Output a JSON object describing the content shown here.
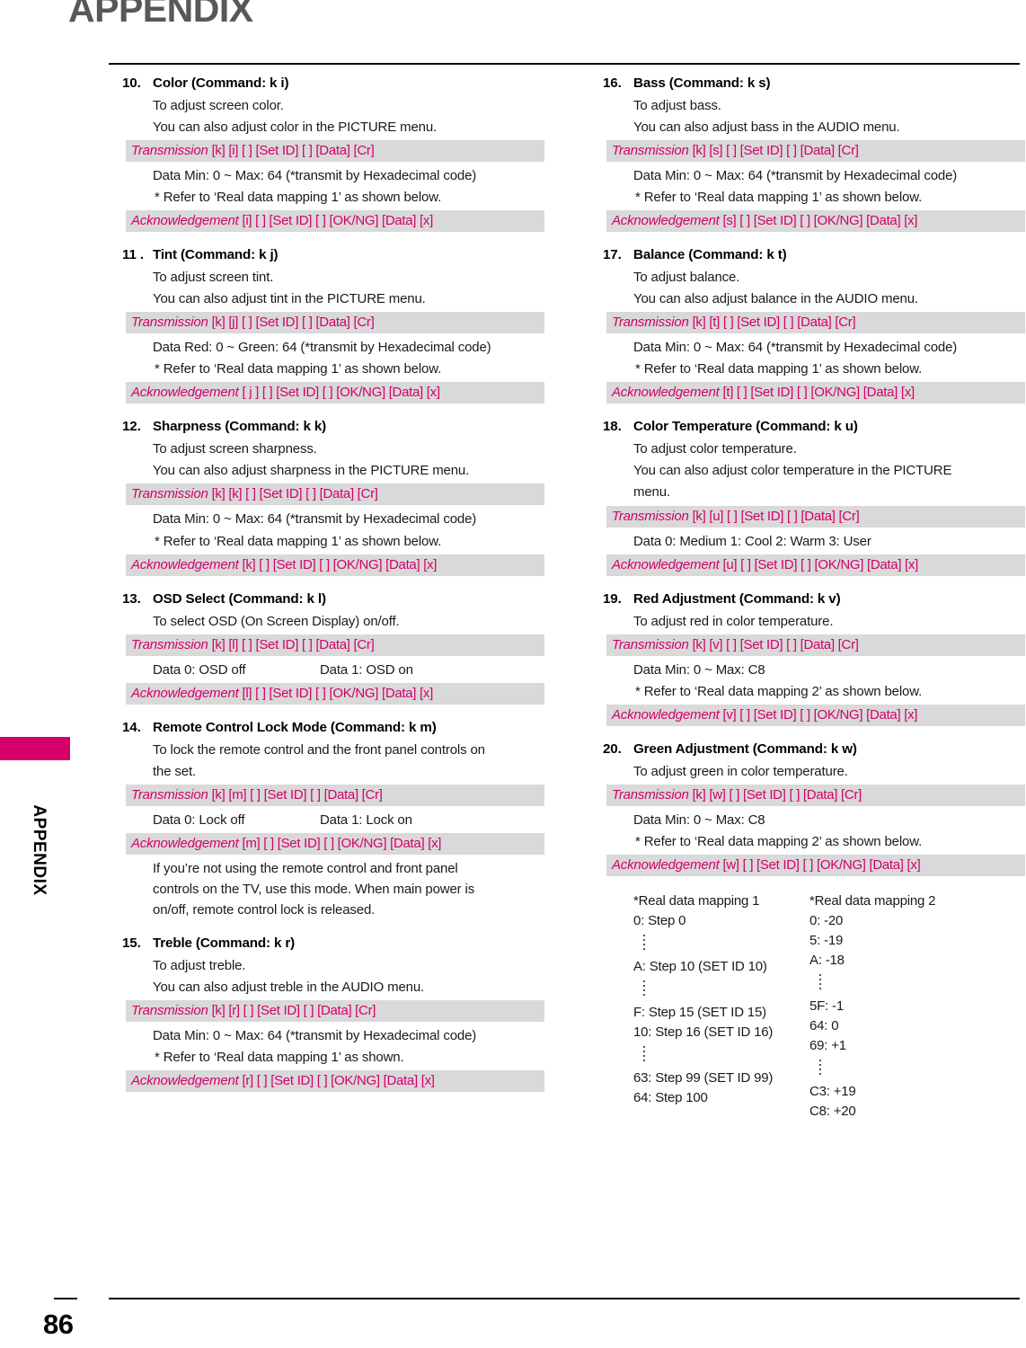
{
  "header": {
    "title": "APPENDIX"
  },
  "side": {
    "tab_label": "APPENDIX"
  },
  "footer": {
    "page_number": "86"
  },
  "items": [
    {
      "num": "10.",
      "title": "Color (Command: k i)",
      "lines": [
        "To adjust screen color.",
        "You can also adjust color in the PICTURE menu."
      ],
      "transmission": {
        "keyword": "Transmission",
        "tokens": "[k] [i] [    ] [Set ID] [    ] [Data] [Cr]"
      },
      "data_lines": [
        "Data Min: 0 ~ Max: 64 (*transmit by Hexadecimal code)"
      ],
      "note": "*  Refer to ‘Real data mapping 1’ as shown below.",
      "ack": {
        "keyword": "Acknowledgement",
        "tokens": "[i] [    ] [Set ID] [    ] [OK/NG] [Data] [x]"
      }
    },
    {
      "num": "11 .",
      "title": "Tint (Command: k j)",
      "lines": [
        "To adjust screen tint.",
        "You can also adjust tint in the PICTURE menu."
      ],
      "transmission": {
        "keyword": "Transmission",
        "tokens": "[k] [j] [    ] [Set ID] [    ] [Data] [Cr]"
      },
      "data_lines": [
        "Data Red: 0 ~ Green: 64 (*transmit by Hexadecimal code)"
      ],
      "note": "*  Refer to ‘Real data mapping 1’ as shown below.",
      "ack": {
        "keyword": "Acknowledgement",
        "tokens": "[ j ] [    ] [Set ID] [    ] [OK/NG] [Data] [x]"
      }
    },
    {
      "num": "12.",
      "title": "Sharpness (Command: k k)",
      "lines": [
        "To adjust screen sharpness.",
        "You can also adjust sharpness in the PICTURE menu."
      ],
      "transmission": {
        "keyword": "Transmission",
        "tokens": "[k] [k] [    ] [Set ID] [    ] [Data] [Cr]"
      },
      "data_lines": [
        "Data Min: 0 ~ Max: 64 (*transmit by Hexadecimal code)"
      ],
      "note": "*  Refer to ‘Real data mapping 1’ as shown below.",
      "ack": {
        "keyword": "Acknowledgement",
        "tokens": "[k] [    ] [Set ID] [    ] [OK/NG] [Data] [x]"
      }
    },
    {
      "num": "13.",
      "title": "OSD Select (Command: k l)",
      "lines": [
        "To select OSD (On Screen Display) on/off."
      ],
      "transmission": {
        "keyword": "Transmission",
        "tokens": "[k] [l] [    ] [Set ID] [    ] [Data] [Cr]"
      },
      "data_pair": {
        "left": "Data 0: OSD off",
        "right": "Data 1: OSD on"
      },
      "ack": {
        "keyword": "Acknowledgement",
        "tokens": "[l] [    ] [Set ID] [    ] [OK/NG] [Data] [x]"
      }
    },
    {
      "num": "14.",
      "title": "Remote Control Lock Mode (Command: k m)",
      "lines": [
        "To lock the remote control and the front panel controls on",
        "the set."
      ],
      "transmission": {
        "keyword": "Transmission",
        "tokens": "[k] [m] [    ] [Set ID] [    ] [Data] [Cr]"
      },
      "data_pair": {
        "left": "Data 0: Lock off",
        "right": "Data 1: Lock on"
      },
      "ack": {
        "keyword": "Acknowledgement",
        "tokens": "[m] [    ] [Set ID] [    ] [OK/NG] [Data] [x]"
      },
      "after_lines": [
        "If you’re not using the remote control and front panel",
        "controls on the TV, use this mode. When main power is",
        "on/off, remote control lock is released."
      ]
    },
    {
      "num": "15.",
      "title": "Treble (Command: k r)",
      "lines": [
        "To adjust treble.",
        "You can also adjust treble in the AUDIO menu."
      ],
      "transmission": {
        "keyword": "Transmission",
        "tokens": "[k] [r] [    ] [Set ID] [    ] [Data] [Cr]"
      },
      "data_lines": [
        "Data Min: 0 ~ Max: 64 (*transmit by Hexadecimal code)"
      ],
      "note": "*  Refer to ‘Real data mapping 1’ as shown.",
      "ack": {
        "keyword": "Acknowledgement",
        "tokens": "[r] [    ] [Set ID] [    ] [OK/NG] [Data] [x]"
      }
    },
    {
      "num": "16.",
      "title": "Bass (Command: k s)",
      "lines": [
        "To adjust bass.",
        "You can also adjust bass in the AUDIO menu."
      ],
      "transmission": {
        "keyword": "Transmission",
        "tokens": "[k] [s] [    ] [Set ID] [    ] [Data] [Cr]"
      },
      "data_lines": [
        "Data Min: 0 ~ Max: 64 (*transmit by Hexadecimal code)"
      ],
      "note": "*  Refer to ‘Real data mapping 1’ as shown below.",
      "ack": {
        "keyword": "Acknowledgement",
        "tokens": "[s] [    ] [Set ID] [    ] [OK/NG] [Data] [x]"
      }
    },
    {
      "num": "17.",
      "title": "Balance (Command: k t)",
      "lines": [
        "To adjust balance.",
        "You can also adjust balance in the AUDIO menu."
      ],
      "transmission": {
        "keyword": "Transmission",
        "tokens": "[k] [t] [    ] [Set ID] [    ] [Data] [Cr]"
      },
      "data_lines": [
        "Data Min: 0 ~ Max: 64 (*transmit by Hexadecimal code)"
      ],
      "note": "*  Refer to ‘Real data mapping 1’ as shown below.",
      "ack": {
        "keyword": "Acknowledgement",
        "tokens": "[t] [    ] [Set ID] [    ] [OK/NG] [Data] [x]"
      }
    },
    {
      "num": "18.",
      "title": "Color Temperature (Command: k u)",
      "lines": [
        "To adjust color temperature.",
        "You can also adjust color temperature in the PICTURE",
        "menu."
      ],
      "transmission": {
        "keyword": "Transmission",
        "tokens": "[k] [u] [    ] [Set ID] [    ] [Data] [Cr]"
      },
      "data_lines": [
        "Data 0: Medium 1: Cool    2: Warm    3: User"
      ],
      "ack": {
        "keyword": "Acknowledgement",
        "tokens": "[u] [    ] [Set ID] [    ] [OK/NG] [Data] [x]"
      }
    },
    {
      "num": "19.",
      "title": "Red Adjustment (Command: k v)",
      "lines": [
        "To adjust red in color temperature."
      ],
      "transmission": {
        "keyword": "Transmission",
        "tokens": "[k] [v] [    ] [Set ID] [    ] [Data] [Cr]"
      },
      "data_lines": [
        "Data Min: 0 ~ Max: C8"
      ],
      "note": "*  Refer to ‘Real data mapping 2’ as shown below.",
      "ack": {
        "keyword": "Acknowledgement",
        "tokens": "[v] [    ] [Set ID] [    ] [OK/NG] [Data] [x]"
      }
    },
    {
      "num": "20.",
      "title": "Green Adjustment (Command: k w)",
      "lines": [
        "To adjust green in color temperature."
      ],
      "transmission": {
        "keyword": "Transmission",
        "tokens": "[k] [w] [    ] [Set ID] [    ] [Data] [Cr]"
      },
      "data_lines": [
        "Data Min: 0 ~ Max: C8"
      ],
      "note": "*  Refer to ‘Real data mapping 2’ as shown below.",
      "ack": {
        "keyword": "Acknowledgement",
        "tokens": "[w] [    ] [Set ID] [    ] [OK/NG] [Data] [x]"
      }
    }
  ],
  "mapping": {
    "col1": {
      "title": "*Real data mapping 1",
      "rows": [
        "0: Step 0",
        "⋮",
        "A: Step 10 (SET ID 10)",
        "⋮",
        "F: Step 15 (SET ID 15)",
        "10: Step 16 (SET ID 16)",
        "⋮",
        "63: Step 99 (SET ID 99)",
        "64: Step 100"
      ]
    },
    "col2": {
      "title": "*Real data mapping 2",
      "rows": [
        "0: -20",
        "5: -19",
        "A: -18",
        "⋮",
        "5F: -1",
        "64: 0",
        "69: +1",
        "⋮",
        "C3: +19",
        "C8: +20"
      ]
    }
  },
  "colors": {
    "accent": "#d4006a",
    "band_bg": "#d9d9d9",
    "title_gray": "#58585a"
  }
}
